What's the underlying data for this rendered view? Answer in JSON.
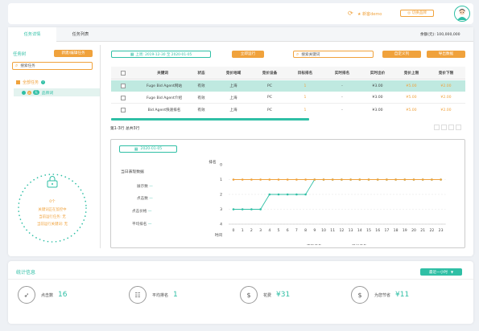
{
  "header": {
    "user_label": "★ 新客demo",
    "switch_label": "◎ 切换品牌"
  },
  "tabs": [
    {
      "label": "任务详情"
    },
    {
      "label": "任务列表"
    }
  ],
  "budget": "余额(元): 100,000,000",
  "tree": {
    "title": "任务树",
    "new_btn": "新建/编辑任务",
    "search_placeholder": "搜索任务",
    "all_tasks": "全部任务",
    "child_tag1": "8",
    "child_tag2": "无",
    "child_label": "品牌词"
  },
  "empty_hint": {
    "count": "0个",
    "line1": "关键词正在监控中",
    "line2": "当前运行任务: 无",
    "line3": "当前运行关键词: 无"
  },
  "toolbar": {
    "date_range": "上周: 2019-12-30 至 2020-01-05",
    "run_btn": "立即运行",
    "kw_placeholder": "搜索关键词",
    "custom_btn": "自定义列",
    "export_btn": "导出数据"
  },
  "table": {
    "headers": [
      "关键词",
      "状态",
      "竞价地域",
      "竞价设备",
      "目标排名",
      "实时排名",
      "实时出价",
      "竞价上限",
      "竞价下限"
    ],
    "rows": [
      {
        "kw": "Fuge Bid Agent网站",
        "status": "有效",
        "region": "上海",
        "device": "PC",
        "target": "1",
        "rank": "-",
        "bid": "¥3.00",
        "up": "¥5.00",
        "low": "¥2.00"
      },
      {
        "kw": "Fuge Bid Agent介绍",
        "status": "有效",
        "region": "上海",
        "device": "PC",
        "target": "1",
        "rank": "-",
        "bid": "¥3.00",
        "up": "¥5.00",
        "low": "¥2.00"
      },
      {
        "kw": "Bid Agent快速排名",
        "status": "有效",
        "region": "上海",
        "device": "PC",
        "target": "1",
        "rank": "-",
        "bid": "¥3.00",
        "up": "¥5.00",
        "low": "¥2.00"
      }
    ],
    "pagination": "第1-3行  总共3行"
  },
  "detail": {
    "date": "2020-01-05",
    "subtitle": "当日表现数据",
    "metrics": [
      {
        "label": "展示数",
        "value": "—"
      },
      {
        "label": "点击数",
        "value": "—"
      },
      {
        "label": "点击价格",
        "value": "—"
      },
      {
        "label": "平均排名",
        "value": "—"
      }
    ]
  },
  "chart_data": {
    "type": "line",
    "ylabel": "排名",
    "xlabel": "时间",
    "yticks": [
      "0",
      "1",
      "2",
      "3",
      "4"
    ],
    "x": [
      "0",
      "1",
      "2",
      "3",
      "4",
      "5",
      "6",
      "7",
      "8",
      "9",
      "10",
      "11",
      "12",
      "13",
      "14",
      "15",
      "16",
      "17",
      "18",
      "19",
      "20",
      "21",
      "22",
      "23"
    ],
    "ylim_reversed": [
      0,
      4
    ],
    "series": [
      {
        "name": "实际排名",
        "color": "#2fbfa5",
        "values": [
          3,
          3,
          3,
          3,
          2,
          2,
          2,
          2,
          2,
          1,
          1,
          1,
          1,
          1,
          1,
          1,
          1,
          1,
          1,
          1,
          1,
          1,
          1,
          1
        ]
      },
      {
        "name": "目标排名",
        "color": "#f0a23c",
        "values": [
          1,
          1,
          1,
          1,
          1,
          1,
          1,
          1,
          1,
          1,
          1,
          1,
          1,
          1,
          1,
          1,
          1,
          1,
          1,
          1,
          1,
          1,
          1,
          1
        ]
      }
    ]
  },
  "stats": {
    "title": "统计信息",
    "period": "最近一小时",
    "items": [
      {
        "label": "点击数",
        "value": "16"
      },
      {
        "label": "平均排名",
        "value": "1"
      },
      {
        "label": "花费",
        "value": "¥31"
      },
      {
        "label": "为您节省",
        "value": "¥11"
      }
    ]
  }
}
